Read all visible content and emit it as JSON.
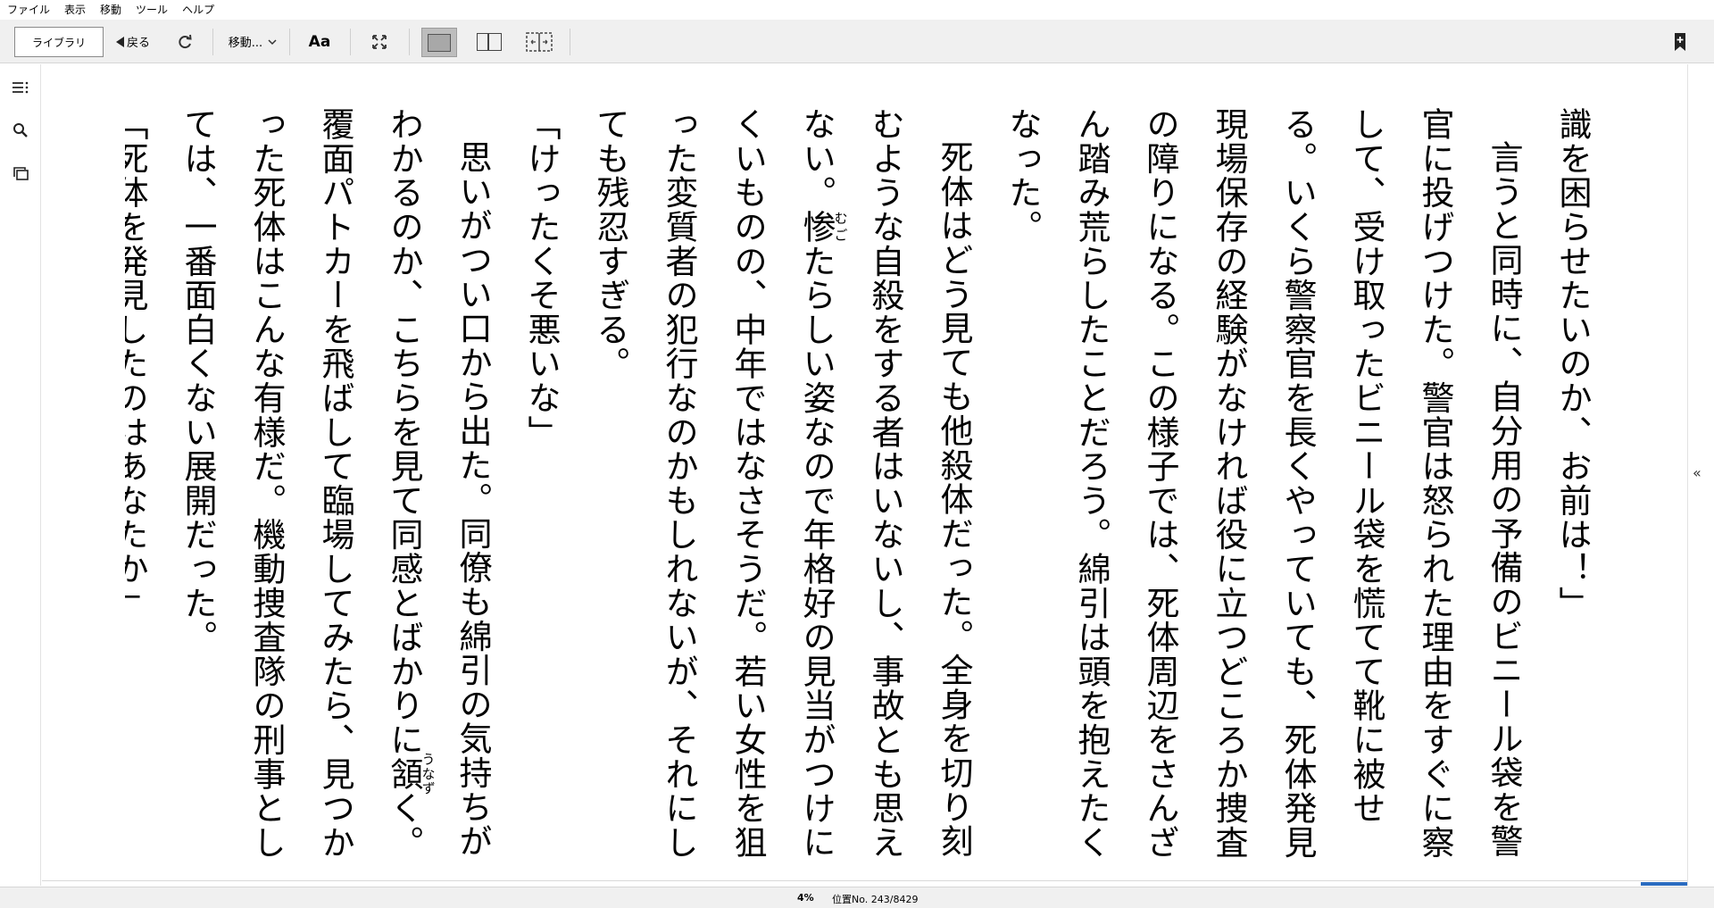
{
  "menu": [
    "ファイル",
    "表示",
    "移動",
    "ツール",
    "ヘルプ"
  ],
  "toolbar": {
    "library_label": "ライブラリ",
    "back_label": "戻る",
    "goto_label": "移動...",
    "font_label": "Aa"
  },
  "page": {
    "columns": [
      "識を困らせたいのか、お前は！」",
      "言うと同時に、自分用の予備のビニール袋を警官に投げつけた。警官は怒られた理由をすぐに察して、受け取ったビニール袋を慌てて靴に被せる。いくら警察官を長くやっていても、死体発見現場保存の経験がなければ役に立つどころか捜査の障りになる。この様子では、死体周辺をさんざん踏み荒らしたことだろう。綿引は頭を抱えたくなった。",
      "死体はどう見ても他殺体だった。全身を切り刻むような自殺をする者はいないし、事故とも思えない。",
      "たらしい姿なので年格好の見当がつけにくいものの、中年ではなさそうだ。若い女性を狙った変質者の犯行なのかもしれないが、それにしても残忍すぎる。",
      "「けったくそ悪いな」",
      "思いがつい口から出た。同僚も綿引の気持ちがわかるのか、こちらを見て同感とばかりに",
      "く。覆面パトカーを飛ばして臨場してみたら、見つかった死体はこんな有様だ。機動捜査隊の刑事としては、一番面白くない展開だった。",
      "「死体を発見したのはあなたか」"
    ],
    "ruby_mugo_base": "惨",
    "ruby_mugo_reading": "むご",
    "ruby_unazu_base": "頷",
    "ruby_unazu_reading": "うなず"
  },
  "status": {
    "percent": "4%",
    "location": "位置No. 243/8429"
  },
  "icons": {
    "toc": "toc-icon",
    "search": "search-icon",
    "flashcards": "flashcards-icon",
    "bookmark": "bookmark-add-icon",
    "collapse": "collapse-arrow-icon"
  }
}
